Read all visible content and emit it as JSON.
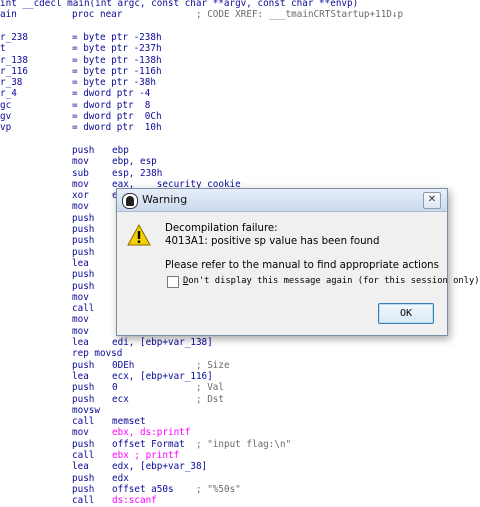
{
  "listing": [
    {
      "label": "int __cdecl main(int argc, const char **argv, const char **envp)",
      "op": "",
      "args": "",
      "comment": ""
    },
    {
      "label": "ain",
      "op": "proc near",
      "args": "",
      "comment": "; CODE XREF: ___tmainCRTStartup+11D↓p"
    },
    {
      "label": "",
      "op": "",
      "args": "",
      "comment": ""
    },
    {
      "label": "r_238",
      "op": "= byte ptr -238h",
      "args": "",
      "comment": ""
    },
    {
      "label": "t",
      "op": "= byte ptr -237h",
      "args": "",
      "comment": ""
    },
    {
      "label": "r_138",
      "op": "= byte ptr -138h",
      "args": "",
      "comment": ""
    },
    {
      "label": "r_116",
      "op": "= byte ptr -116h",
      "args": "",
      "comment": ""
    },
    {
      "label": "r_38",
      "op": "= byte ptr -38h",
      "args": "",
      "comment": ""
    },
    {
      "label": "r_4",
      "op": "= dword ptr -4",
      "args": "",
      "comment": ""
    },
    {
      "label": "gc",
      "op": "= dword ptr  8",
      "args": "",
      "comment": ""
    },
    {
      "label": "gv",
      "op": "= dword ptr  0Ch",
      "args": "",
      "comment": ""
    },
    {
      "label": "vp",
      "op": "= dword ptr  10h",
      "args": "",
      "comment": ""
    },
    {
      "label": "",
      "op": "",
      "args": "",
      "comment": ""
    },
    {
      "label": "",
      "op": "push",
      "args": "ebp",
      "comment": ""
    },
    {
      "label": "",
      "op": "mov",
      "args": "ebp, esp",
      "comment": ""
    },
    {
      "label": "",
      "op": "sub",
      "args": "esp, 238h",
      "comment": ""
    },
    {
      "label": "",
      "op": "mov",
      "args": "eax, ___security_cookie",
      "comment": ""
    },
    {
      "label": "",
      "op": "xor",
      "args": "eax, ebp",
      "comment": ""
    },
    {
      "label": "",
      "op": "mov",
      "args": "",
      "comment": ""
    },
    {
      "label": "",
      "op": "push",
      "args": "",
      "comment": ""
    },
    {
      "label": "",
      "op": "push",
      "args": "",
      "comment": ""
    },
    {
      "label": "",
      "op": "push",
      "args": "",
      "comment": ""
    },
    {
      "label": "",
      "op": "push",
      "args": "",
      "comment": ""
    },
    {
      "label": "",
      "op": "lea",
      "args": "",
      "comment": ""
    },
    {
      "label": "",
      "op": "push",
      "args": "",
      "comment": ""
    },
    {
      "label": "",
      "op": "push",
      "args": "",
      "comment": ""
    },
    {
      "label": "",
      "op": "mov",
      "args": "",
      "comment": ""
    },
    {
      "label": "",
      "op": "call",
      "args": "",
      "comment": ""
    },
    {
      "label": "",
      "op": "mov",
      "args": "",
      "comment": ""
    },
    {
      "label": "",
      "op": "mov",
      "args": "",
      "comment": ""
    },
    {
      "label": "",
      "op": "lea",
      "args": "edi, [ebp+var_138]",
      "comment": ""
    },
    {
      "label": "",
      "op": "rep movsd",
      "args": "",
      "comment": ""
    },
    {
      "label": "",
      "op": "push",
      "args": "0DEh",
      "comment": "; Size"
    },
    {
      "label": "",
      "op": "lea",
      "args": "ecx, [ebp+var_116]",
      "comment": ""
    },
    {
      "label": "",
      "op": "push",
      "args": "0",
      "comment": "; Val"
    },
    {
      "label": "",
      "op": "push",
      "args": "ecx",
      "comment": "; Dst"
    },
    {
      "label": "",
      "op": "movsw",
      "args": "",
      "comment": ""
    },
    {
      "label": "",
      "op": "call",
      "args": "memset",
      "comment": ""
    },
    {
      "label": "",
      "op": "mov",
      "args": "ebx, ds:printf",
      "comment": ""
    },
    {
      "label": "",
      "op": "push",
      "args": "offset Format",
      "comment": "; \"input flag:\\n\""
    },
    {
      "label": "",
      "op": "call",
      "args": "ebx ; printf",
      "comment": ""
    },
    {
      "label": "",
      "op": "lea",
      "args": "edx, [ebp+var_38]",
      "comment": ""
    },
    {
      "label": "",
      "op": "push",
      "args": "edx",
      "comment": ""
    },
    {
      "label": "",
      "op": "push",
      "args": "offset a50s",
      "comment": "; \"%50s\""
    },
    {
      "label": "",
      "op": "call",
      "args": "ds:scanf",
      "comment": ""
    }
  ],
  "dialog": {
    "title": "Warning",
    "close_glyph": "✕",
    "message_line1": "Decompilation failure:",
    "message_line2": "4013A1: positive sp value has been found",
    "message_line3": "Please refer to the manual to find appropriate actions",
    "checkbox_mnemonic": "D",
    "checkbox_label_rest": "on't display this message again (for this session only)",
    "ok_label": "OK",
    "warn_icon": "warning-triangle-icon",
    "app_icon": "ida-app-icon"
  }
}
